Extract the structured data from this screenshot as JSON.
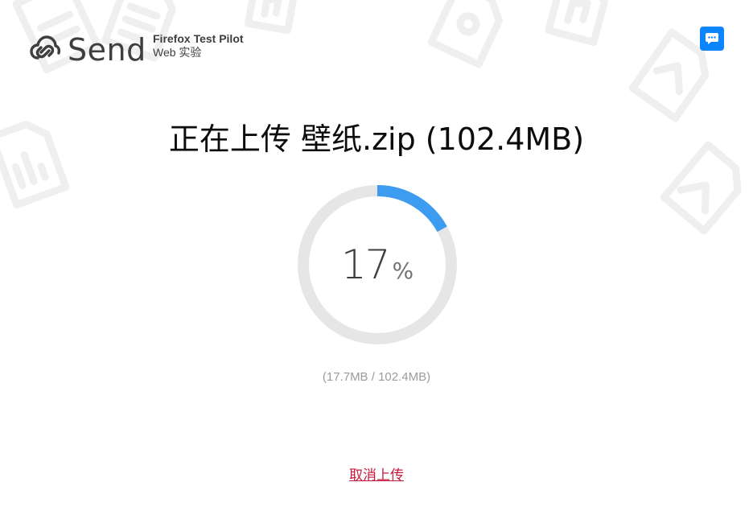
{
  "header": {
    "app_name": "Send",
    "pilot_title": "Firefox Test Pilot",
    "pilot_subtitle": "Web 实验",
    "logo_icon": "send-logo-icon",
    "feedback_icon": "chat-bubble-icon",
    "feedback_color": "#0a84ff"
  },
  "upload": {
    "title": "正在上传 壁纸.zip (102.4MB)",
    "progress": {
      "percent": 17,
      "percent_label": "17",
      "percent_sign": "%",
      "track_color": "#e6e6e6",
      "fill_color": "#3d9cf0"
    },
    "size_text": "(17.7MB / 102.4MB)",
    "cancel_label": "取消上传",
    "cancel_color": "#c4193b"
  }
}
